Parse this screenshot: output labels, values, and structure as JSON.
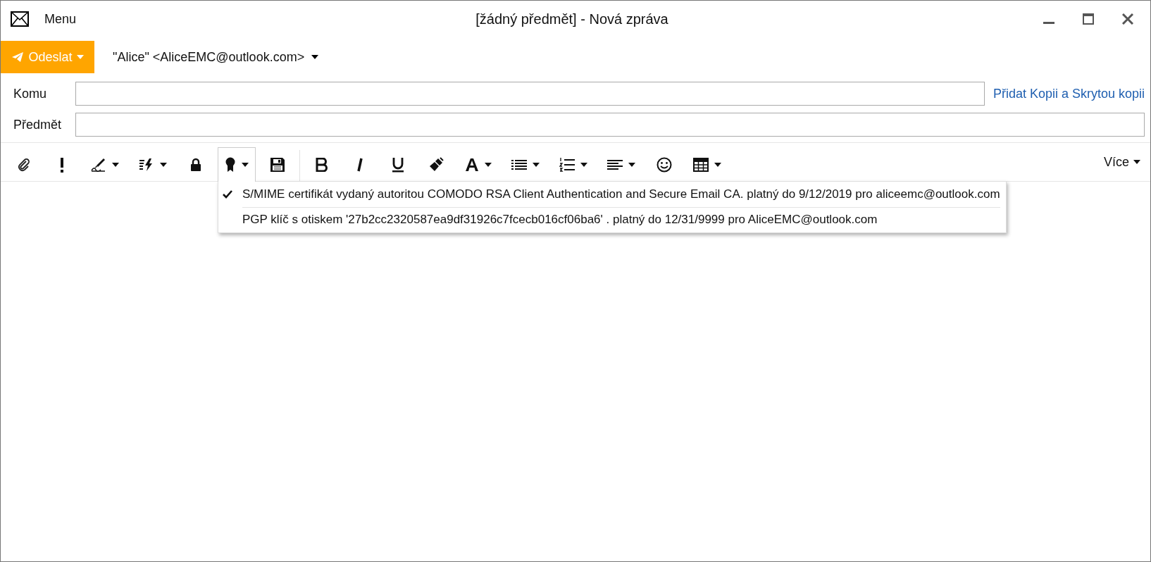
{
  "window": {
    "title": "[žádný předmět] - Nová zpráva",
    "menu_label": "Menu"
  },
  "send_button": {
    "label": "Odeslat"
  },
  "sender": "\"Alice\" <AliceEMC@outlook.com>",
  "fields": [
    {
      "label": "Komu"
    },
    {
      "label": "Předmět"
    }
  ],
  "cc_link": "Přidat Kopii a Skrytou kopii",
  "toolbar_groups": [
    [
      {
        "kind": "attach",
        "dropdown": false,
        "selected": false
      },
      {
        "kind": "importance",
        "dropdown": false,
        "selected": false
      },
      {
        "kind": "signature",
        "dropdown": true,
        "selected": false
      },
      {
        "kind": "quick",
        "dropdown": true,
        "selected": false
      },
      {
        "kind": "encrypt",
        "dropdown": false,
        "selected": false
      },
      {
        "kind": "certificate",
        "dropdown": true,
        "selected": true
      },
      {
        "kind": "save",
        "dropdown": false,
        "selected": false
      }
    ],
    [
      {
        "kind": "bold",
        "dropdown": false,
        "selected": false
      },
      {
        "kind": "italic",
        "dropdown": false,
        "selected": false
      },
      {
        "kind": "underline",
        "dropdown": false,
        "selected": false
      },
      {
        "kind": "brush",
        "dropdown": false,
        "selected": false
      },
      {
        "kind": "font-color",
        "dropdown": true,
        "selected": false
      },
      {
        "kind": "bullets",
        "dropdown": true,
        "selected": false
      },
      {
        "kind": "numbering",
        "dropdown": true,
        "selected": false
      },
      {
        "kind": "align",
        "dropdown": true,
        "selected": false
      },
      {
        "kind": "emoji",
        "dropdown": false,
        "selected": false
      },
      {
        "kind": "table",
        "dropdown": true,
        "selected": false
      }
    ]
  ],
  "more_button": "Více",
  "certificate_menu": [
    {
      "label": "S/MIME certifikát vydaný autoritou COMODO RSA Client Authentication and Secure Email CA. platný do 9/12/2019 pro aliceemc@outlook.com",
      "checked": true
    },
    {
      "label": "PGP klíč s otiskem '27b2cc2320587ea9df31926c7fcecb016cf06ba6' . platný do 12/31/9999 pro AliceEMC@outlook.com",
      "checked": false
    }
  ]
}
